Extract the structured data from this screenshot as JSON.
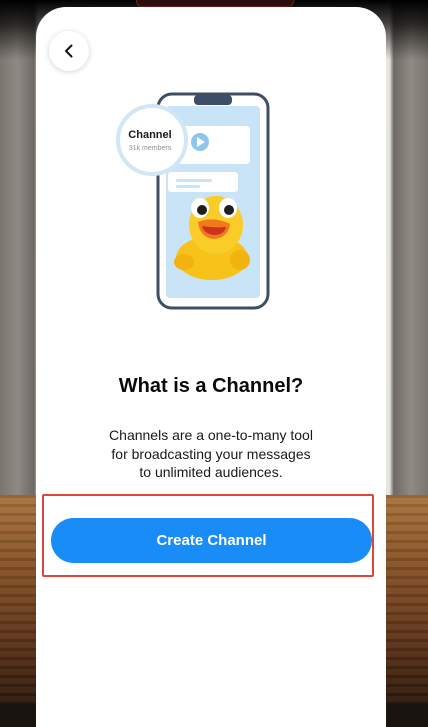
{
  "illustration": {
    "bubble_title": "Channel",
    "bubble_subtitle": "31k members"
  },
  "heading": "What is a Channel?",
  "description_lines": [
    "Channels are a one-to-many tool",
    "for broadcasting your messages",
    "to unlimited audiences."
  ],
  "primary_button": "Create Channel",
  "colors": {
    "accent": "#1a8cf7",
    "highlight_border": "#e0453a",
    "phone_screen": "#c9e3f7",
    "duck": "#f7c21a"
  }
}
